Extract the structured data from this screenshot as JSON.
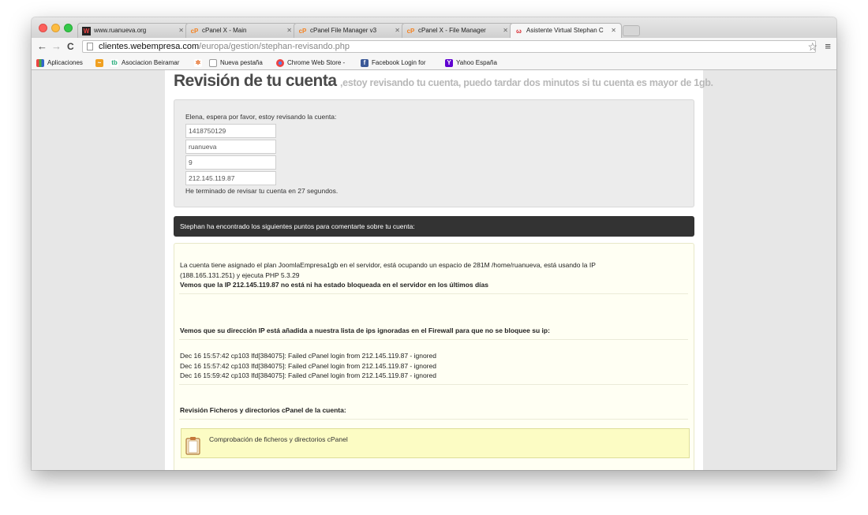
{
  "tabs": [
    {
      "label": "www.ruanueva.org",
      "favicon": "ruanueva-favicon"
    },
    {
      "label": "cPanel X - Main",
      "favicon": "cpanel-favicon"
    },
    {
      "label": "cPanel File Manager v3",
      "favicon": "cpanel-favicon"
    },
    {
      "label": "cPanel X - File Manager",
      "favicon": "cpanel-favicon"
    },
    {
      "label": "Asistente Virtual Stephan C",
      "favicon": "webempresa-favicon",
      "active": true
    }
  ],
  "address": {
    "host": "clientes.webempresa.com",
    "path": "/europa/gestion/stephan-revisando.php"
  },
  "bookmarks": [
    {
      "label": "Aplicaciones",
      "icon": "apps-grid-icon"
    },
    {
      "label": "",
      "icon": "chart-bookmark-icon"
    },
    {
      "label": "Asociacion Beiramar",
      "icon": "tb-bookmark-icon"
    },
    {
      "label": "",
      "icon": "joomla-bookmark-icon"
    },
    {
      "label": "Nueva pestaña",
      "icon": "page-icon"
    },
    {
      "label": "Chrome Web Store -",
      "icon": "chrome-store-icon"
    },
    {
      "label": "Facebook Login for",
      "icon": "facebook-icon"
    },
    {
      "label": "Yahoo España",
      "icon": "yahoo-icon"
    }
  ],
  "page": {
    "title": "Revisión de tu cuenta",
    "subtitle": ",estoy revisando tu cuenta, puedo tardar dos minutos si tu cuenta es mayor de 1gb.",
    "check": {
      "intro": "Elena, espera por favor, estoy revisando la cuenta:",
      "fields": [
        "1418750129",
        "ruanueva",
        "9",
        "212.145.119.87"
      ],
      "done": "He terminado de revisar tu cuenta en 27 segundos."
    },
    "bar": "Stephan ha encontrado los siguientes puntos para comentarte sobre tu cuenta:",
    "report": {
      "plan_line1": "La cuenta tiene asignado el plan JoomlaEmpresa1gb en el servidor, está ocupando un espacio de 281M /home/ruanueva, está usando la IP",
      "plan_line2": "(188.165.131.251) y ejecuta PHP 5.3.29",
      "ip_status": "Vemos que la IP 212.145.119.87 no está ni ha estado bloqueada en el servidor en los últimos días",
      "firewall_heading": "Vemos que su dirección IP está añadida a nuestra lista de ips ignoradas en el Firewall para que no se bloquee su ip:",
      "log": [
        "Dec 16 15:57:42 cp103 lfd[384075]: Failed cPanel login from 212.145.119.87 - ignored",
        "Dec 16 15:57:42 cp103 lfd[384075]: Failed cPanel login from 212.145.119.87 - ignored",
        "Dec 16 15:59:42 cp103 lfd[384075]: Failed cPanel login from 212.145.119.87 - ignored"
      ],
      "files_heading": "Revisión Ficheros y directorios cPanel de la cuenta:",
      "note": "Comprobación de ficheros y directorios cPanel"
    }
  }
}
